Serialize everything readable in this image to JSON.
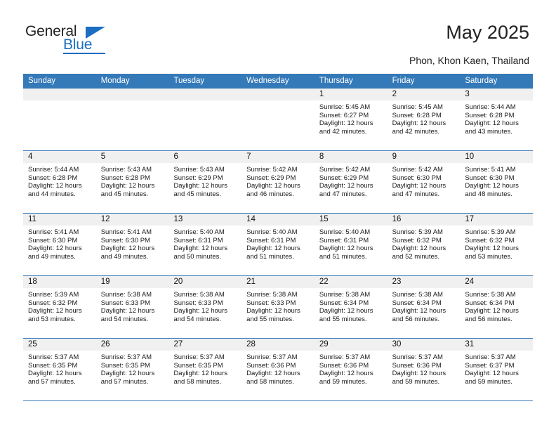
{
  "brand": {
    "name_top": "General",
    "name_bottom": "Blue"
  },
  "header": {
    "title": "May 2025",
    "subtitle": "Phon, Khon Kaen, Thailand"
  },
  "colors": {
    "header_blue": "#3479b8",
    "brand_blue": "#1b6ec2",
    "day_strip_gray": "#f0f0f0"
  },
  "weekdays": [
    "Sunday",
    "Monday",
    "Tuesday",
    "Wednesday",
    "Thursday",
    "Friday",
    "Saturday"
  ],
  "weeks": [
    [
      {
        "day": "",
        "sunrise": "",
        "sunset": "",
        "daylight_1": "",
        "daylight_2": ""
      },
      {
        "day": "",
        "sunrise": "",
        "sunset": "",
        "daylight_1": "",
        "daylight_2": ""
      },
      {
        "day": "",
        "sunrise": "",
        "sunset": "",
        "daylight_1": "",
        "daylight_2": ""
      },
      {
        "day": "",
        "sunrise": "",
        "sunset": "",
        "daylight_1": "",
        "daylight_2": ""
      },
      {
        "day": "1",
        "sunrise": "Sunrise: 5:45 AM",
        "sunset": "Sunset: 6:27 PM",
        "daylight_1": "Daylight: 12 hours",
        "daylight_2": "and 42 minutes."
      },
      {
        "day": "2",
        "sunrise": "Sunrise: 5:45 AM",
        "sunset": "Sunset: 6:28 PM",
        "daylight_1": "Daylight: 12 hours",
        "daylight_2": "and 42 minutes."
      },
      {
        "day": "3",
        "sunrise": "Sunrise: 5:44 AM",
        "sunset": "Sunset: 6:28 PM",
        "daylight_1": "Daylight: 12 hours",
        "daylight_2": "and 43 minutes."
      }
    ],
    [
      {
        "day": "4",
        "sunrise": "Sunrise: 5:44 AM",
        "sunset": "Sunset: 6:28 PM",
        "daylight_1": "Daylight: 12 hours",
        "daylight_2": "and 44 minutes."
      },
      {
        "day": "5",
        "sunrise": "Sunrise: 5:43 AM",
        "sunset": "Sunset: 6:28 PM",
        "daylight_1": "Daylight: 12 hours",
        "daylight_2": "and 45 minutes."
      },
      {
        "day": "6",
        "sunrise": "Sunrise: 5:43 AM",
        "sunset": "Sunset: 6:29 PM",
        "daylight_1": "Daylight: 12 hours",
        "daylight_2": "and 45 minutes."
      },
      {
        "day": "7",
        "sunrise": "Sunrise: 5:42 AM",
        "sunset": "Sunset: 6:29 PM",
        "daylight_1": "Daylight: 12 hours",
        "daylight_2": "and 46 minutes."
      },
      {
        "day": "8",
        "sunrise": "Sunrise: 5:42 AM",
        "sunset": "Sunset: 6:29 PM",
        "daylight_1": "Daylight: 12 hours",
        "daylight_2": "and 47 minutes."
      },
      {
        "day": "9",
        "sunrise": "Sunrise: 5:42 AM",
        "sunset": "Sunset: 6:30 PM",
        "daylight_1": "Daylight: 12 hours",
        "daylight_2": "and 47 minutes."
      },
      {
        "day": "10",
        "sunrise": "Sunrise: 5:41 AM",
        "sunset": "Sunset: 6:30 PM",
        "daylight_1": "Daylight: 12 hours",
        "daylight_2": "and 48 minutes."
      }
    ],
    [
      {
        "day": "11",
        "sunrise": "Sunrise: 5:41 AM",
        "sunset": "Sunset: 6:30 PM",
        "daylight_1": "Daylight: 12 hours",
        "daylight_2": "and 49 minutes."
      },
      {
        "day": "12",
        "sunrise": "Sunrise: 5:41 AM",
        "sunset": "Sunset: 6:30 PM",
        "daylight_1": "Daylight: 12 hours",
        "daylight_2": "and 49 minutes."
      },
      {
        "day": "13",
        "sunrise": "Sunrise: 5:40 AM",
        "sunset": "Sunset: 6:31 PM",
        "daylight_1": "Daylight: 12 hours",
        "daylight_2": "and 50 minutes."
      },
      {
        "day": "14",
        "sunrise": "Sunrise: 5:40 AM",
        "sunset": "Sunset: 6:31 PM",
        "daylight_1": "Daylight: 12 hours",
        "daylight_2": "and 51 minutes."
      },
      {
        "day": "15",
        "sunrise": "Sunrise: 5:40 AM",
        "sunset": "Sunset: 6:31 PM",
        "daylight_1": "Daylight: 12 hours",
        "daylight_2": "and 51 minutes."
      },
      {
        "day": "16",
        "sunrise": "Sunrise: 5:39 AM",
        "sunset": "Sunset: 6:32 PM",
        "daylight_1": "Daylight: 12 hours",
        "daylight_2": "and 52 minutes."
      },
      {
        "day": "17",
        "sunrise": "Sunrise: 5:39 AM",
        "sunset": "Sunset: 6:32 PM",
        "daylight_1": "Daylight: 12 hours",
        "daylight_2": "and 53 minutes."
      }
    ],
    [
      {
        "day": "18",
        "sunrise": "Sunrise: 5:39 AM",
        "sunset": "Sunset: 6:32 PM",
        "daylight_1": "Daylight: 12 hours",
        "daylight_2": "and 53 minutes."
      },
      {
        "day": "19",
        "sunrise": "Sunrise: 5:38 AM",
        "sunset": "Sunset: 6:33 PM",
        "daylight_1": "Daylight: 12 hours",
        "daylight_2": "and 54 minutes."
      },
      {
        "day": "20",
        "sunrise": "Sunrise: 5:38 AM",
        "sunset": "Sunset: 6:33 PM",
        "daylight_1": "Daylight: 12 hours",
        "daylight_2": "and 54 minutes."
      },
      {
        "day": "21",
        "sunrise": "Sunrise: 5:38 AM",
        "sunset": "Sunset: 6:33 PM",
        "daylight_1": "Daylight: 12 hours",
        "daylight_2": "and 55 minutes."
      },
      {
        "day": "22",
        "sunrise": "Sunrise: 5:38 AM",
        "sunset": "Sunset: 6:34 PM",
        "daylight_1": "Daylight: 12 hours",
        "daylight_2": "and 55 minutes."
      },
      {
        "day": "23",
        "sunrise": "Sunrise: 5:38 AM",
        "sunset": "Sunset: 6:34 PM",
        "daylight_1": "Daylight: 12 hours",
        "daylight_2": "and 56 minutes."
      },
      {
        "day": "24",
        "sunrise": "Sunrise: 5:38 AM",
        "sunset": "Sunset: 6:34 PM",
        "daylight_1": "Daylight: 12 hours",
        "daylight_2": "and 56 minutes."
      }
    ],
    [
      {
        "day": "25",
        "sunrise": "Sunrise: 5:37 AM",
        "sunset": "Sunset: 6:35 PM",
        "daylight_1": "Daylight: 12 hours",
        "daylight_2": "and 57 minutes."
      },
      {
        "day": "26",
        "sunrise": "Sunrise: 5:37 AM",
        "sunset": "Sunset: 6:35 PM",
        "daylight_1": "Daylight: 12 hours",
        "daylight_2": "and 57 minutes."
      },
      {
        "day": "27",
        "sunrise": "Sunrise: 5:37 AM",
        "sunset": "Sunset: 6:35 PM",
        "daylight_1": "Daylight: 12 hours",
        "daylight_2": "and 58 minutes."
      },
      {
        "day": "28",
        "sunrise": "Sunrise: 5:37 AM",
        "sunset": "Sunset: 6:36 PM",
        "daylight_1": "Daylight: 12 hours",
        "daylight_2": "and 58 minutes."
      },
      {
        "day": "29",
        "sunrise": "Sunrise: 5:37 AM",
        "sunset": "Sunset: 6:36 PM",
        "daylight_1": "Daylight: 12 hours",
        "daylight_2": "and 59 minutes."
      },
      {
        "day": "30",
        "sunrise": "Sunrise: 5:37 AM",
        "sunset": "Sunset: 6:36 PM",
        "daylight_1": "Daylight: 12 hours",
        "daylight_2": "and 59 minutes."
      },
      {
        "day": "31",
        "sunrise": "Sunrise: 5:37 AM",
        "sunset": "Sunset: 6:37 PM",
        "daylight_1": "Daylight: 12 hours",
        "daylight_2": "and 59 minutes."
      }
    ]
  ]
}
